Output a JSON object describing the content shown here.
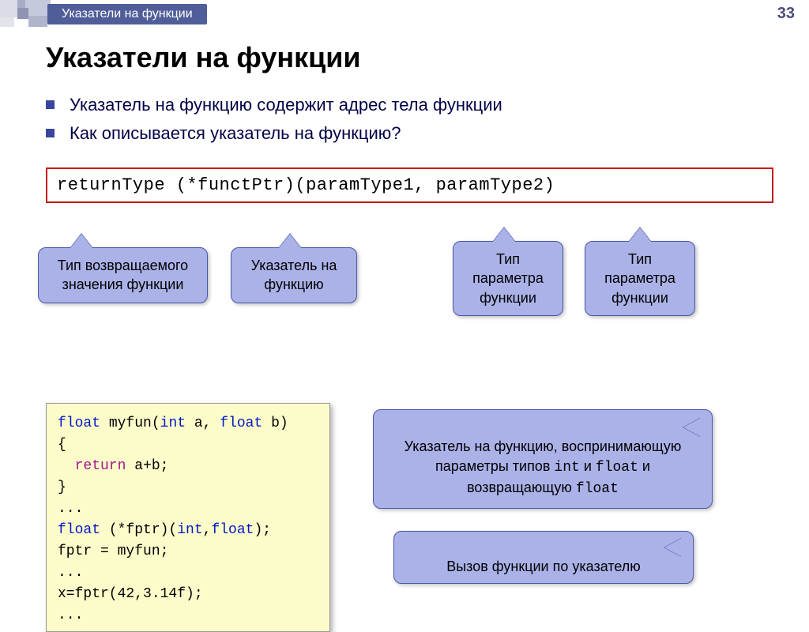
{
  "header": {
    "title": "Указатели на функции",
    "page_number": "33"
  },
  "main": {
    "heading": "Указатели на функции",
    "bullets": [
      "Указатель на функцию содержит адрес тела функции",
      "Как описывается указатель на функцию?"
    ],
    "syntax": "returnType  (*functPtr)(paramType1, paramType2)",
    "callouts_top": [
      "Тип возвращаемого значения функции",
      "Указатель на функцию",
      "Тип параметра функции",
      "Тип параметра функции"
    ],
    "code": {
      "l1a": "float",
      "l1b": " myfun(",
      "l1c": "int",
      "l1d": " a, ",
      "l1e": "float",
      "l1f": " b)",
      "l2": "{",
      "l3a": "  return",
      "l3b": " a+b;",
      "l4": "}",
      "l5": "...",
      "l6a": "float",
      "l6b": " (*fptr)(",
      "l6c": "int",
      "l6d": ",",
      "l6e": "float",
      "l6f": ");",
      "l7": "fptr = myfun;",
      "l8": "...",
      "l9": "x=fptr(42,3.14f);",
      "l10": "..."
    },
    "callout_desc": {
      "p1": "Указатель на функцию, воспринимающую параметры типов ",
      "t1": "int",
      "p2": " и ",
      "t2": "float",
      "p3": " и возвращающую ",
      "t3": "float"
    },
    "callout_call": "Вызов функции по указателю"
  }
}
